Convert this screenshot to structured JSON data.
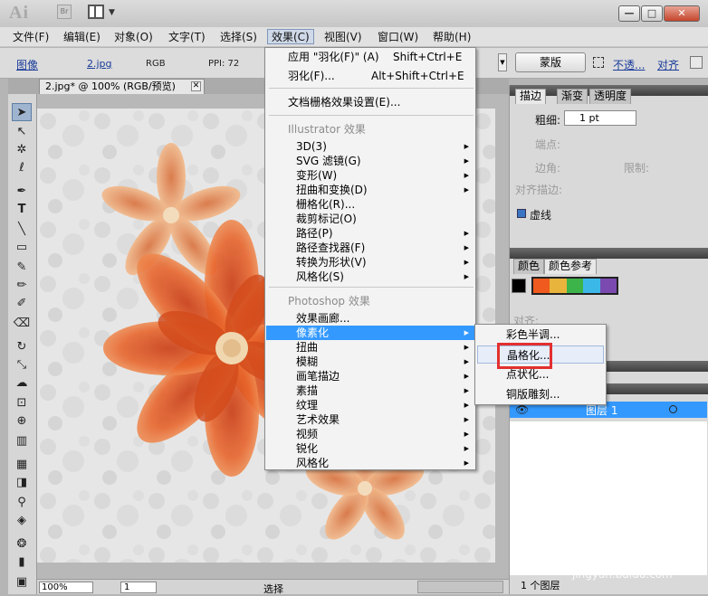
{
  "titlebar": {
    "app_logo": "Ai",
    "bridge_label": "Br"
  },
  "menubar": {
    "items": [
      "文件(F)",
      "编辑(E)",
      "对象(O)",
      "文字(T)",
      "选择(S)",
      "效果(C)",
      "视图(V)",
      "窗口(W)",
      "帮助(H)"
    ]
  },
  "controlbar": {
    "image_label": "图像",
    "file_name": "2.jpg",
    "color_mode": "RGB",
    "ppi": "PPI: 72",
    "mask_button": "蒙版",
    "opacity_link": "不透...",
    "align_link": "对齐"
  },
  "document": {
    "tab_title": "2.jpg* @ 100% (RGB/预览)"
  },
  "statusbar": {
    "zoom": "100%",
    "page": "1",
    "tool_label": "选择"
  },
  "effect_menu": {
    "apply_label": "应用 \"羽化(F)\" (A)",
    "apply_shortcut": "Shift+Ctrl+E",
    "feather_label": "羽化(F)...",
    "feather_shortcut": "Alt+Shift+Ctrl+E",
    "raster_settings": "文档栅格效果设置(E)...",
    "illustrator_header": "Illustrator 效果",
    "illustrator_items": [
      "3D(3)",
      "SVG 滤镜(G)",
      "变形(W)",
      "扭曲和变换(D)",
      "栅格化(R)...",
      "裁剪标记(O)",
      "路径(P)",
      "路径查找器(F)",
      "转换为形状(V)",
      "风格化(S)"
    ],
    "photoshop_header": "Photoshop 效果",
    "photoshop_items": [
      "效果画廊...",
      "像素化",
      "扭曲",
      "模糊",
      "画笔描边",
      "素描",
      "纹理",
      "艺术效果",
      "视频",
      "锐化",
      "风格化"
    ]
  },
  "pixelate_submenu": {
    "items": [
      "彩色半调...",
      "晶格化...",
      "点状化...",
      "铜版雕刻..."
    ]
  },
  "panel": {
    "stroke_tabs": [
      "描边",
      "渐变",
      "透明度"
    ],
    "weight_label": "粗细:",
    "weight_value": "1 pt",
    "cap_label": "端点:",
    "corner_label": "边角:",
    "limit_label": "限制:",
    "align_stroke_label": "对齐描边:",
    "dashed_label": "虚线",
    "color_tabs": [
      "颜色",
      "颜色参考"
    ],
    "align_label": "对齐:",
    "layer_name": "图层 1",
    "layer_count": "1 个图层"
  },
  "watermark": {
    "brand": "Bai",
    "brand2": "经验",
    "url": "jingyan.baidu.com"
  },
  "colors": {
    "highlight": "#3399ff",
    "swatches": [
      "#f05a1e",
      "#e8b43c",
      "#3db44a",
      "#3cb8e8",
      "#7a4ab0"
    ]
  }
}
